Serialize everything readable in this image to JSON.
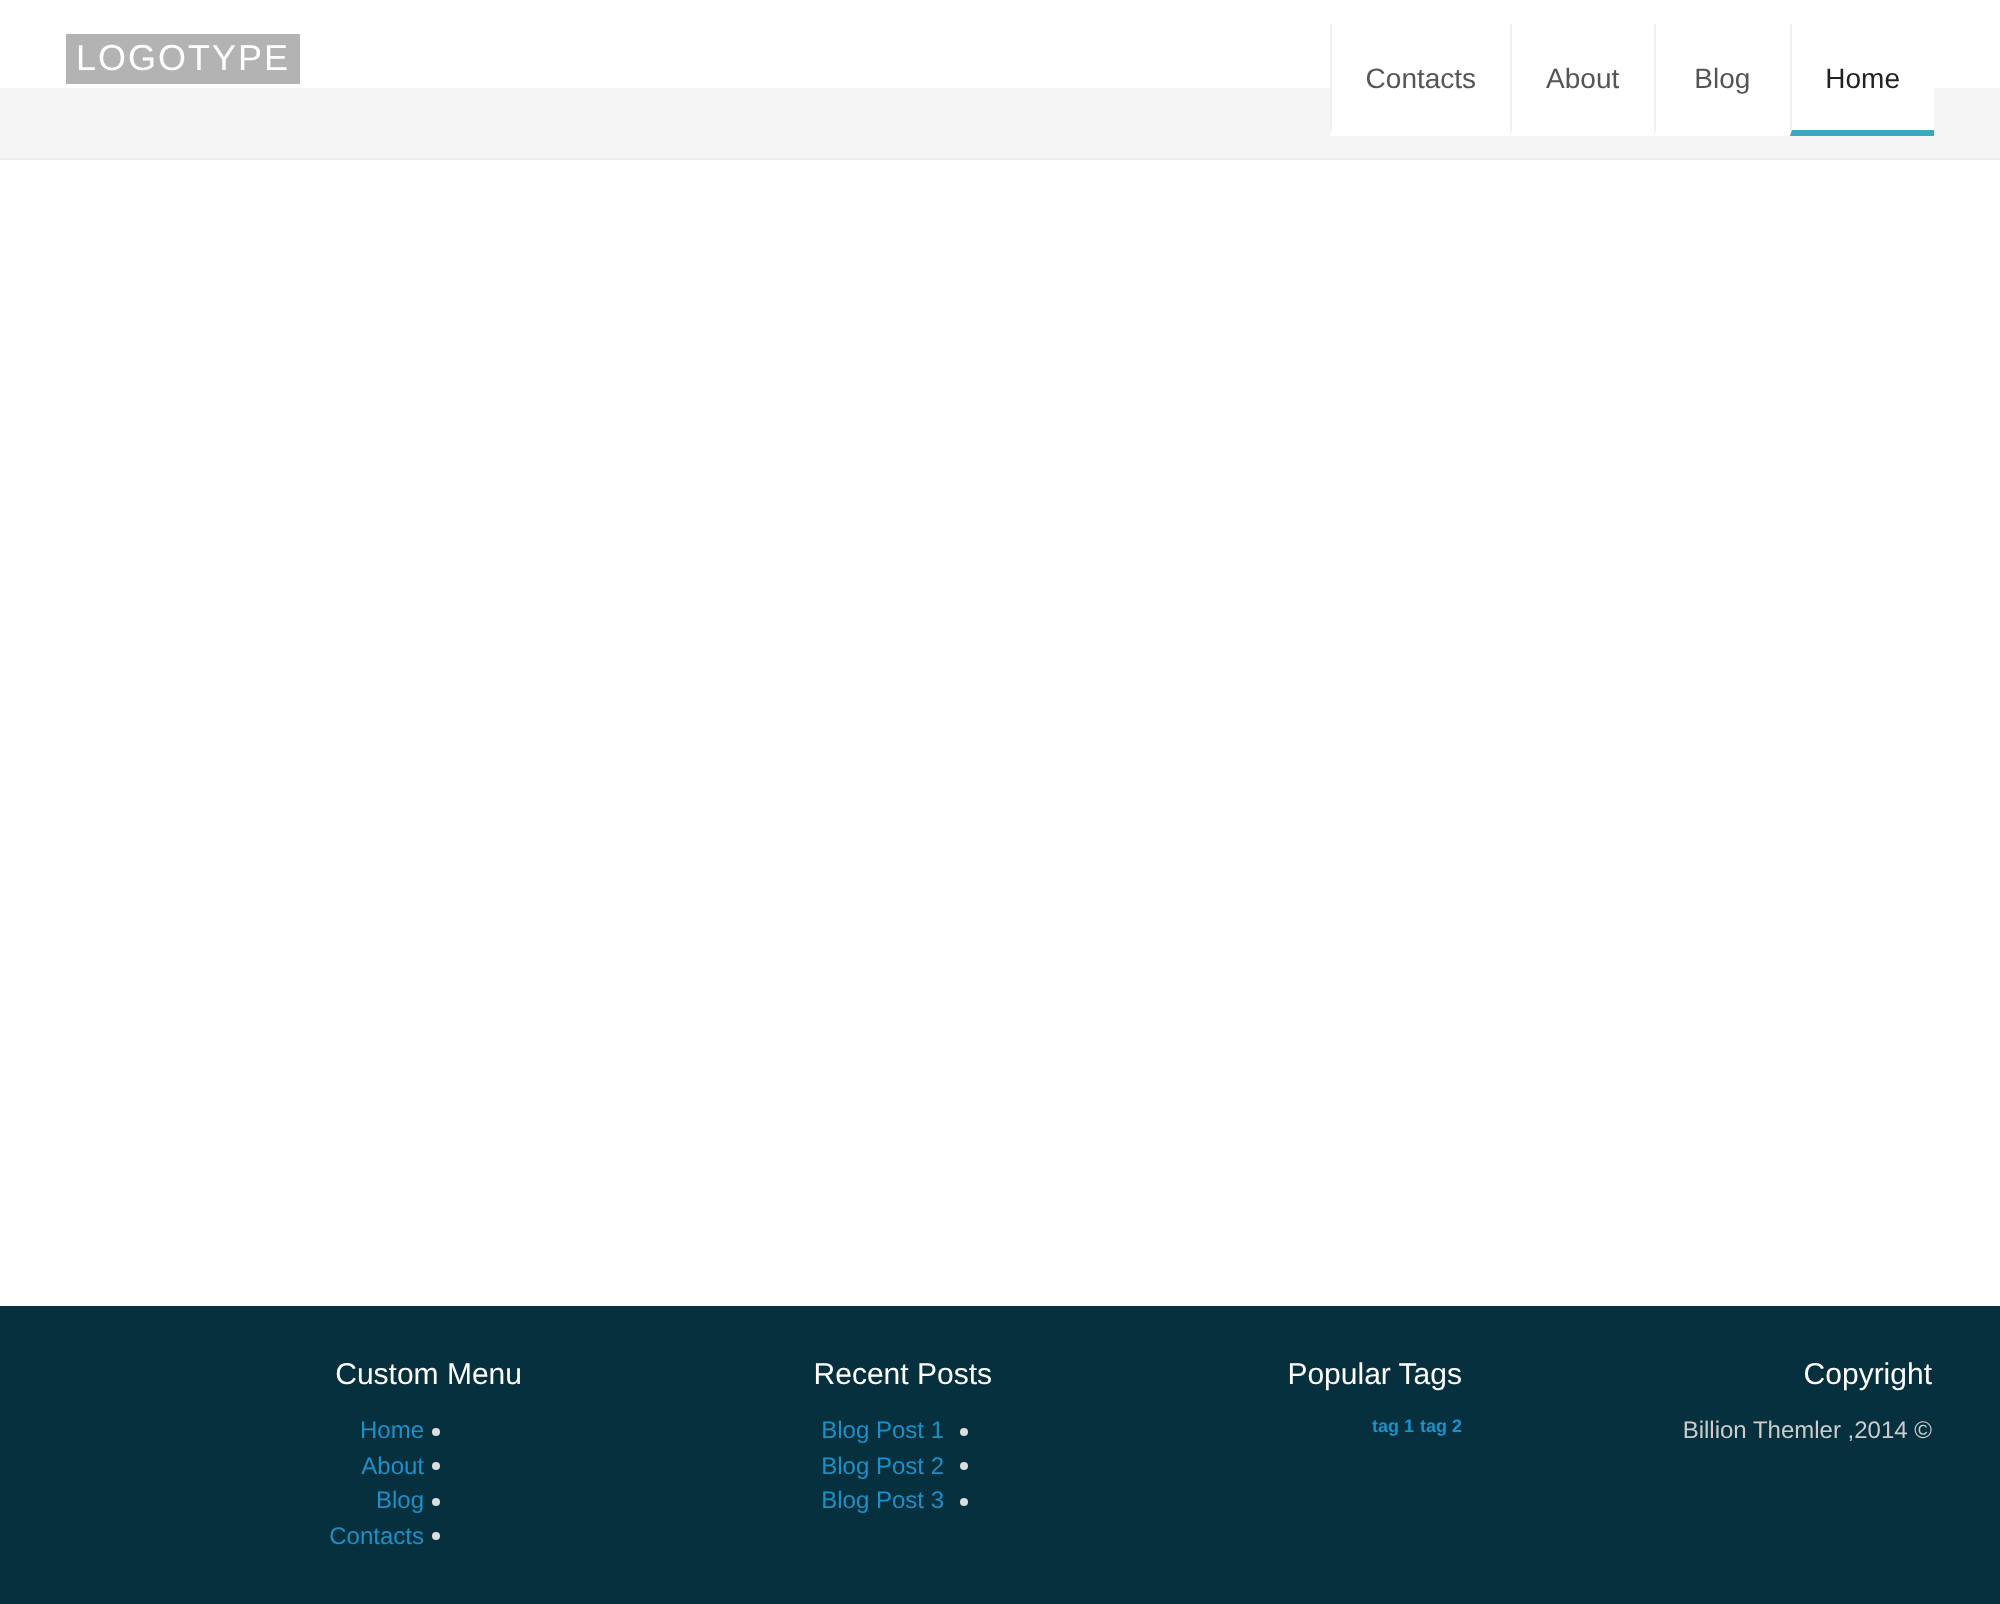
{
  "logo": "LOGOTYPE",
  "nav": [
    {
      "label": "Contacts",
      "selected": false
    },
    {
      "label": "About",
      "selected": false
    },
    {
      "label": "Blog",
      "selected": false
    },
    {
      "label": "Home",
      "selected": true
    }
  ],
  "footer": {
    "columns": [
      {
        "kind": "list",
        "title": "Custom Menu",
        "items": [
          "Home",
          "About",
          "Blog",
          "Contacts"
        ]
      },
      {
        "kind": "list",
        "title": "Recent Posts",
        "items": [
          "Blog Post 1",
          "Blog Post 2",
          "Blog Post 3"
        ]
      },
      {
        "kind": "tags",
        "title": "Popular Tags",
        "items": [
          "tag 1",
          "tag 2"
        ]
      },
      {
        "kind": "text",
        "title": "Copyright",
        "text": "Billion Themler ,2014 ©"
      }
    ]
  }
}
